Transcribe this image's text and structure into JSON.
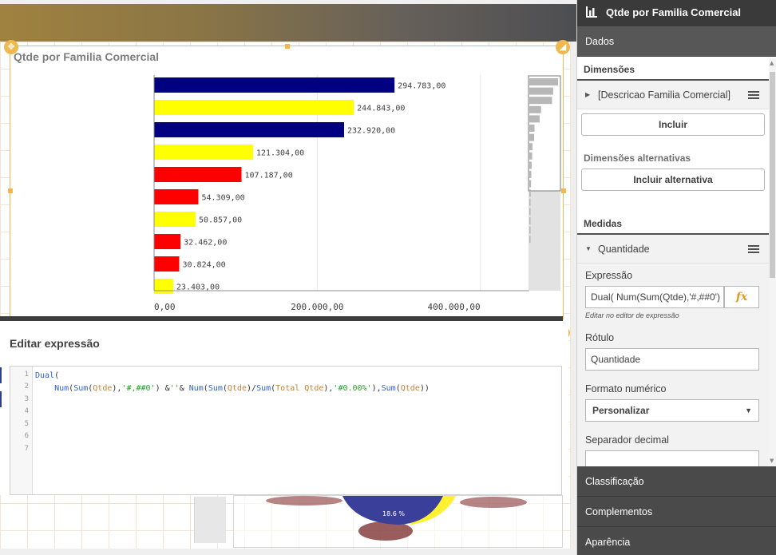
{
  "chart": {
    "title": "Qtde por Familia Comercial",
    "bar_labels": [
      "294.783,00",
      "244.843,00",
      "232.920,00",
      "121.304,00",
      "107.187,00",
      "54.309,00",
      "50.857,00",
      "32.462,00",
      "30.824,00",
      "23.403,00"
    ],
    "axis_ticks": [
      "0,00",
      "200.000,00",
      "400.000,00"
    ]
  },
  "chart_data": {
    "type": "bar",
    "orientation": "horizontal",
    "title": "Qtde por Familia Comercial",
    "values": [
      294783,
      244843,
      232920,
      121304,
      107187,
      54309,
      50857,
      32462,
      30824,
      23403
    ],
    "bar_colors": [
      "#000080",
      "#ffff00",
      "#000080",
      "#ffff00",
      "#ff0000",
      "#ff0000",
      "#ffff00",
      "#ff0000",
      "#ff0000",
      "#ffff00"
    ],
    "xlim": [
      0,
      460000
    ],
    "x_ticks": [
      0,
      200000,
      400000
    ],
    "minimap_values": [
      1.0,
      0.83,
      0.79,
      0.41,
      0.36,
      0.18,
      0.17,
      0.11,
      0.1,
      0.08,
      0.07,
      0.06,
      0.05,
      0.04,
      0.03,
      0.03,
      0.02,
      0.02
    ]
  },
  "editor": {
    "title": "Editar expressão",
    "line_numbers": [
      "1",
      "2",
      "3",
      "4",
      "5",
      "6",
      "7"
    ]
  },
  "pie": {
    "label": "18.6 %"
  },
  "props": {
    "header": "Qtde por Familia Comercial",
    "tab_data": "Dados",
    "dimensions_heading": "Dimensões",
    "dimension_item": "[Descricao Familia Comercial]",
    "include_button": "Incluir",
    "alt_dimensions_label": "Dimensões alternativas",
    "include_alt_button": "Incluir alternativa",
    "measures_heading": "Medidas",
    "measure_item": "Quantidade",
    "expression_label": "Expressão",
    "expression_value": "Dual(    Num(Sum(Qtde),'#,##0')",
    "fx_label": "fx",
    "expression_hint": "Editar no editor de expressão",
    "label_label": "Rótulo",
    "label_value": "Quantidade",
    "number_format_label": "Formato numérico",
    "number_format_value": "Personalizar",
    "decimal_sep_label": "Separador decimal",
    "tab_sorting": "Classificação",
    "tab_addons": "Complementos",
    "tab_appearance": "Aparência"
  },
  "colors": {
    "accent_selection": "#f0b84f",
    "panel_dark": "#4a4a4a"
  }
}
